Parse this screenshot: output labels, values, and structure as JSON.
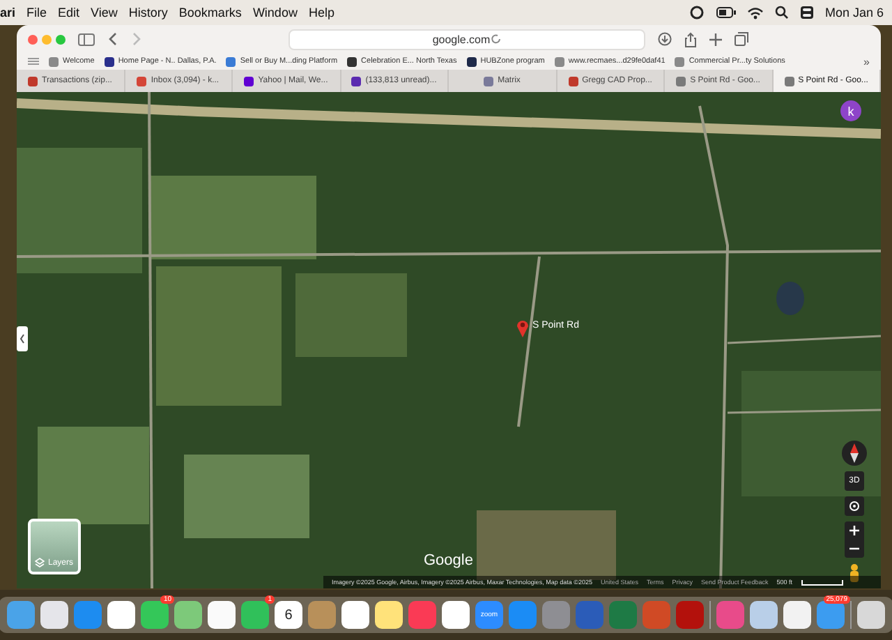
{
  "menu_bar": {
    "app": "ari",
    "items": [
      "File",
      "Edit",
      "View",
      "History",
      "Bookmarks",
      "Window",
      "Help"
    ],
    "clock": "Mon Jan 6"
  },
  "toolbar": {
    "address": "google.com"
  },
  "bookmarks": [
    {
      "label": "Welcome",
      "color": "#8a8a8a"
    },
    {
      "label": "Home Page - N.. Dallas, P.A.",
      "color": "#2a2f8c"
    },
    {
      "label": "Sell or Buy M...ding Platform",
      "color": "#3a7bd5"
    },
    {
      "label": "Celebration E... North Texas",
      "color": "#333333"
    },
    {
      "label": "HUBZone program",
      "color": "#1f2a4a"
    },
    {
      "label": "www.recmaes...d29fe0daf41",
      "color": "#8a8a8a"
    },
    {
      "label": "Commercial Pr...ty Solutions",
      "color": "#8a8a8a"
    }
  ],
  "bookmarks_more": "»",
  "tabs": [
    {
      "label": "Transactions (zip...",
      "selected": false,
      "color": "#c0392b"
    },
    {
      "label": "Inbox (3,094) - k...",
      "selected": false,
      "color": "#d44638"
    },
    {
      "label": "Yahoo | Mail, We...",
      "selected": false,
      "color": "#6001d2"
    },
    {
      "label": "(133,813 unread)...",
      "selected": false,
      "color": "#5b2bb0"
    },
    {
      "label": "Matrix",
      "selected": false,
      "color": "#7a7a9a"
    },
    {
      "label": "Gregg CAD Prop...",
      "selected": false,
      "color": "#c0392b"
    },
    {
      "label": "S Point Rd - Goo...",
      "selected": false,
      "color": "#7a7a7a"
    },
    {
      "label": "S Point Rd - Goo...",
      "selected": true,
      "color": "#7a7a7a"
    }
  ],
  "map": {
    "account_initial": "k",
    "pin_label": "S Point Rd",
    "layers_label": "Layers",
    "three_d": "3D",
    "logo": "Google",
    "attribution": "Imagery ©2025 Google, Airbus, Imagery ©2025 Airbus, Maxar Technologies, Map data ©2025",
    "footer_links": [
      "United States",
      "Terms",
      "Privacy",
      "Send Product Feedback"
    ],
    "scale": "500 ft"
  },
  "dock": [
    {
      "kind": "finder"
    },
    {
      "kind": "grid"
    },
    {
      "kind": "compass"
    },
    {
      "kind": "chrome"
    },
    {
      "kind": "messages",
      "badge": "10"
    },
    {
      "kind": "maps"
    },
    {
      "kind": "photos"
    },
    {
      "kind": "facetime",
      "badge": "1"
    },
    {
      "kind": "calendar",
      "day": "6"
    },
    {
      "kind": "notes-brown"
    },
    {
      "kind": "reminders"
    },
    {
      "kind": "notes"
    },
    {
      "kind": "music"
    },
    {
      "kind": "news"
    },
    {
      "kind": "zoom",
      "label": "zoom"
    },
    {
      "kind": "appstore"
    },
    {
      "kind": "settings"
    },
    {
      "kind": "word"
    },
    {
      "kind": "excel"
    },
    {
      "kind": "powerpoint"
    },
    {
      "kind": "acrobat"
    },
    {
      "kind": "cloud"
    },
    {
      "kind": "preview"
    },
    {
      "kind": "acrobat-light"
    },
    {
      "kind": "mail",
      "badge": "25,079"
    },
    {
      "kind": "trash"
    }
  ]
}
